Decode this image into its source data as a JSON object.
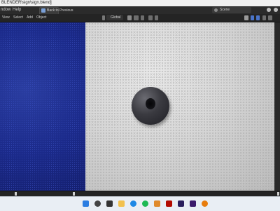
{
  "titlebar": {
    "path": "BLENDER\\sign\\sign.blend]"
  },
  "menubar": {
    "items": [
      "ndow",
      "Help"
    ],
    "back_button": "Back to Previous",
    "scene_label": "Scene"
  },
  "toolbar": {
    "items": [
      "View",
      "Select",
      "Add",
      "Object"
    ],
    "orientation": "Global"
  },
  "colors": {
    "accent": "#4a74c9",
    "wall": "#d6d6d6",
    "blue_panel": "#1b2a8a",
    "knob": "#3a3a40"
  },
  "taskbar": {
    "icons": [
      "windows-start-icon",
      "search-icon",
      "task-view-icon",
      "file-explorer-icon",
      "edge-icon",
      "spotify-icon",
      "app-icon",
      "acrobat-icon",
      "after-effects-icon",
      "premiere-icon",
      "blender-icon"
    ]
  }
}
